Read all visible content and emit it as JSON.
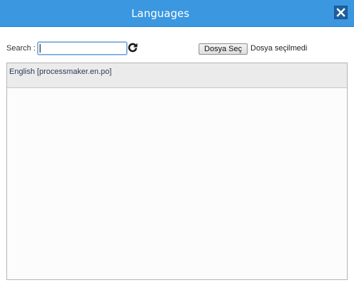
{
  "window": {
    "title": "Languages",
    "close_icon": "close-icon"
  },
  "search": {
    "label": "Search :",
    "value": "",
    "placeholder": "",
    "refresh_icon": "refresh-icon"
  },
  "file_upload": {
    "button_label": "Dosya Seç",
    "status_text": "Dosya seçilmedi"
  },
  "languages": {
    "items": [
      {
        "label": "English [processmaker.en.po]"
      }
    ]
  },
  "colors": {
    "titlebar": "#3a97e0",
    "close_button": "#1f5f9f",
    "list_item_text": "#2b3a5a"
  }
}
